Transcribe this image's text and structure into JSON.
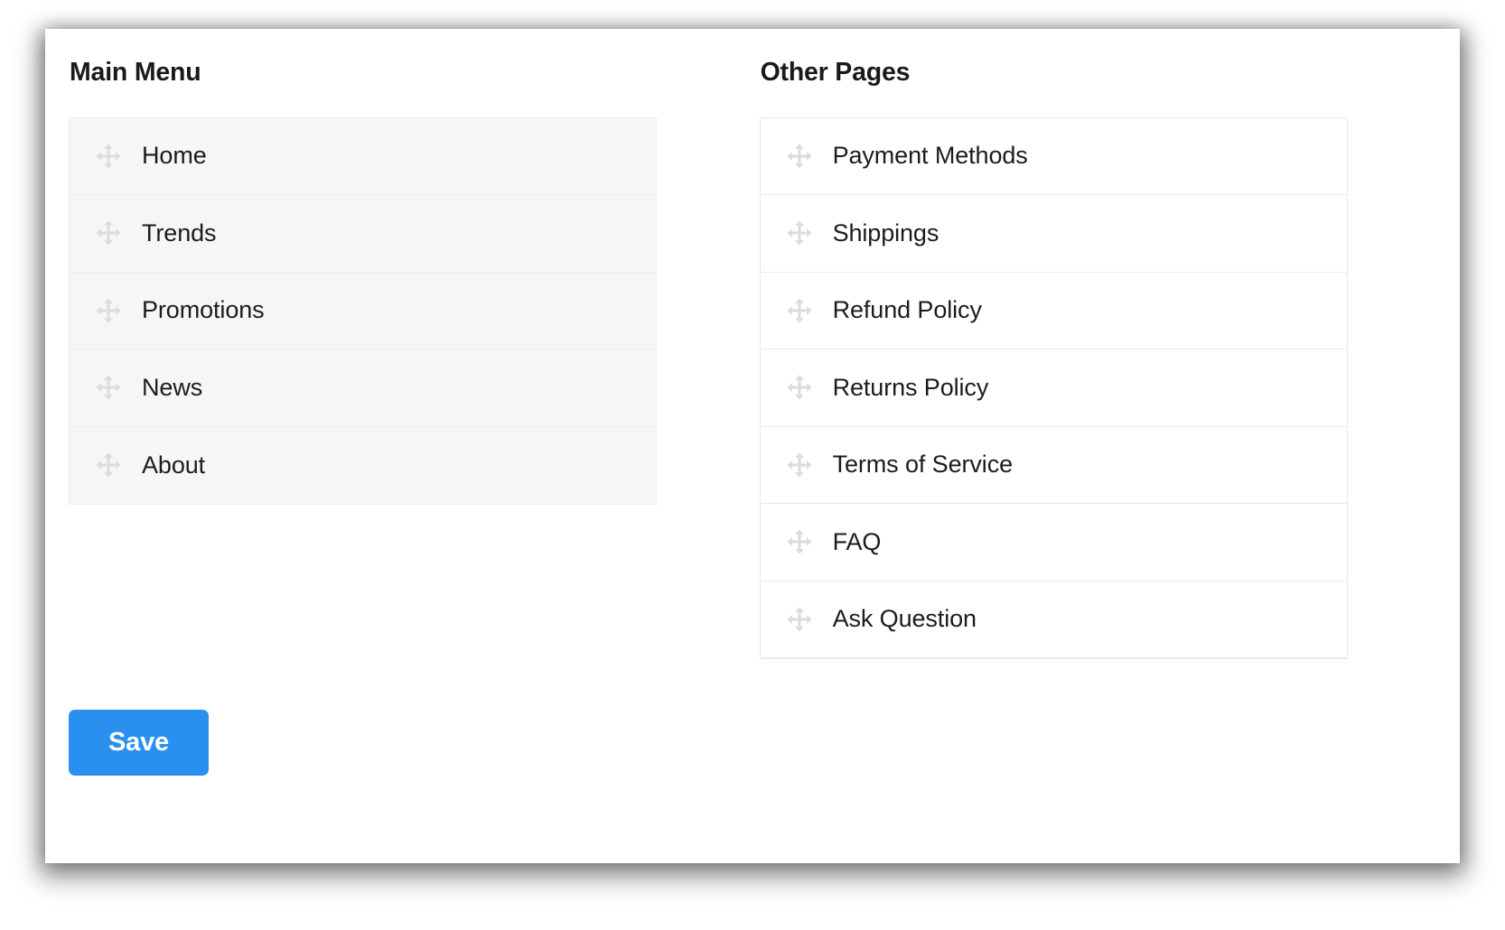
{
  "card": {
    "save": {
      "label": "Save",
      "color": "#2a90f0"
    }
  },
  "columns": [
    {
      "id": "main-menu",
      "title": "Main Menu",
      "style": "shaded",
      "items": [
        {
          "label": "Home",
          "handle_icon": "move-arrows-icon"
        },
        {
          "label": "Trends",
          "handle_icon": "move-arrows-icon"
        },
        {
          "label": "Promotions",
          "handle_icon": "move-arrows-icon"
        },
        {
          "label": "News",
          "handle_icon": "move-arrows-icon"
        },
        {
          "label": "About",
          "handle_icon": "move-arrows-icon"
        }
      ]
    },
    {
      "id": "other-pages",
      "title": "Other Pages",
      "style": "plain",
      "items": [
        {
          "label": "Payment Methods",
          "handle_icon": "move-arrows-icon"
        },
        {
          "label": "Shippings",
          "handle_icon": "move-arrows-icon"
        },
        {
          "label": "Refund Policy",
          "handle_icon": "move-arrows-icon"
        },
        {
          "label": "Returns Policy",
          "handle_icon": "move-arrows-icon"
        },
        {
          "label": "Terms of Service",
          "handle_icon": "move-arrows-icon"
        },
        {
          "label": "FAQ",
          "handle_icon": "move-arrows-icon"
        },
        {
          "label": "Ask Question",
          "handle_icon": "move-arrows-icon"
        }
      ]
    }
  ],
  "theme": {
    "card_background": "#ffffff",
    "shaded_item_background": "#f6f6f6",
    "plain_item_background": "#ffffff",
    "border_color": "#ededed",
    "text_color": "#1c1c1c",
    "handle_color": "#dcdcdc"
  }
}
